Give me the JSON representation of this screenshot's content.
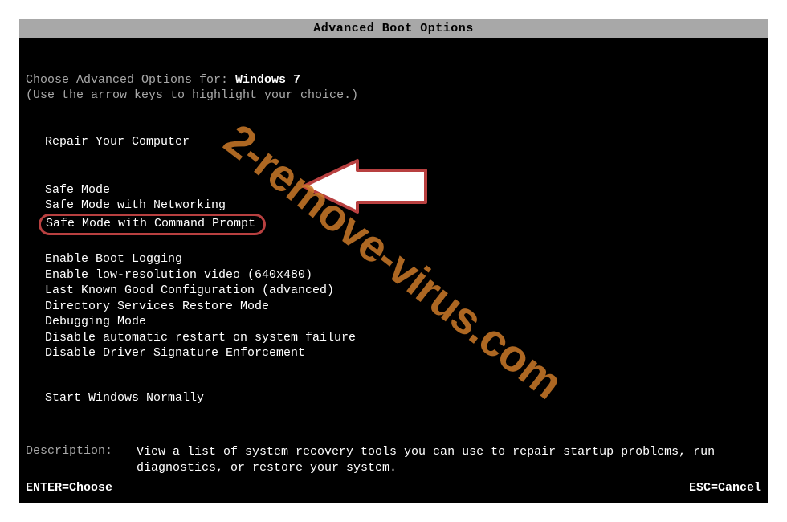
{
  "titlebar": "Advanced Boot Options",
  "heading_prefix": "Choose Advanced Options for: ",
  "os_name": "Windows 7",
  "sub_heading": "(Use the arrow keys to highlight your choice.)",
  "menu": {
    "group1": [
      "Repair Your Computer"
    ],
    "group2": [
      "Safe Mode",
      "Safe Mode with Networking",
      "Safe Mode with Command Prompt"
    ],
    "group3": [
      "Enable Boot Logging",
      "Enable low-resolution video (640x480)",
      "Last Known Good Configuration (advanced)",
      "Directory Services Restore Mode",
      "Debugging Mode",
      "Disable automatic restart on system failure",
      "Disable Driver Signature Enforcement"
    ],
    "group4": [
      "Start Windows Normally"
    ]
  },
  "description_label": "Description:",
  "description_text": "View a list of system recovery tools you can use to repair startup problems, run diagnostics, or restore your system.",
  "footer_left": "ENTER=Choose",
  "footer_right": "ESC=Cancel",
  "watermark": "2-remove-virus.com"
}
